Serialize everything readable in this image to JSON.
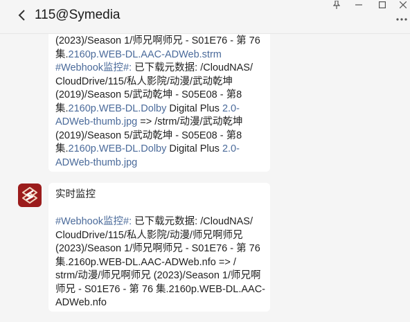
{
  "header": {
    "title": "115@Symedia"
  },
  "messages": [
    {
      "lines": [
        [
          {
            "t": "(2023)/Season 1/师兄啊师兄 - S01E76 - 第 76"
          }
        ],
        [
          {
            "t": "集."
          },
          {
            "t": "2160p.WEB-DL.AAC-ADWeb.strm",
            "link": true
          }
        ],
        [
          {
            "t": "#Webhook监控#:",
            "link": true
          },
          {
            "t": " 已下载元数据: /CloudNAS/"
          }
        ],
        [
          {
            "t": "CloudDrive/115/私人影院/动漫/武动乾坤"
          }
        ],
        [
          {
            "t": "(2019)/Season 5/武动乾坤 - S05E08 - 第8"
          }
        ],
        [
          {
            "t": "集."
          },
          {
            "t": "2160p.WEB-DL.Dolby",
            "link": true
          },
          {
            "t": " Digital Plus "
          },
          {
            "t": "2.0-",
            "link": true
          }
        ],
        [
          {
            "t": "ADWeb-thumb.jpg",
            "link": true
          },
          {
            "t": " => /strm/动漫/武动乾坤"
          }
        ],
        [
          {
            "t": "(2019)/Season 5/武动乾坤 - S05E08 - 第8"
          }
        ],
        [
          {
            "t": "集."
          },
          {
            "t": "2160p.WEB-DL.Dolby",
            "link": true
          },
          {
            "t": " Digital Plus "
          },
          {
            "t": "2.0-",
            "link": true
          }
        ],
        [
          {
            "t": "ADWeb-thumb.jpg",
            "link": true
          }
        ]
      ]
    },
    {
      "lines": [
        [
          {
            "t": "实时监控"
          }
        ],
        [],
        [
          {
            "t": "#Webhook监控#:",
            "link": true
          },
          {
            "t": " 已下载元数据: /CloudNAS/"
          }
        ],
        [
          {
            "t": "CloudDrive/115/私人影院/动漫/师兄啊师兄"
          }
        ],
        [
          {
            "t": "(2023)/Season 1/师兄啊师兄 - S01E76 - 第 76"
          }
        ],
        [
          {
            "t": "集.2160p.WEB-DL.AAC-ADWeb.nfo => /"
          }
        ],
        [
          {
            "t": "strm/动漫/师兄啊师兄 (2023)/Season 1/师兄啊"
          }
        ],
        [
          {
            "t": "师兄 - S01E76 - 第 76 集.2160p.WEB-DL.AAC-"
          }
        ],
        [
          {
            "t": "ADWeb.nfo"
          }
        ]
      ]
    }
  ],
  "icons": {
    "back": "chevron-left-icon",
    "pin": "pin-icon",
    "minimize": "minimize-icon",
    "maximize": "maximize-icon",
    "close": "close-icon",
    "more": "more-icon",
    "avatar": "symedia-logo-icon"
  },
  "colors": {
    "link": "#4a6a9a",
    "avatar_bg": "#9b1c1c",
    "background": "#f5f5f5",
    "bubble": "#ffffff"
  }
}
